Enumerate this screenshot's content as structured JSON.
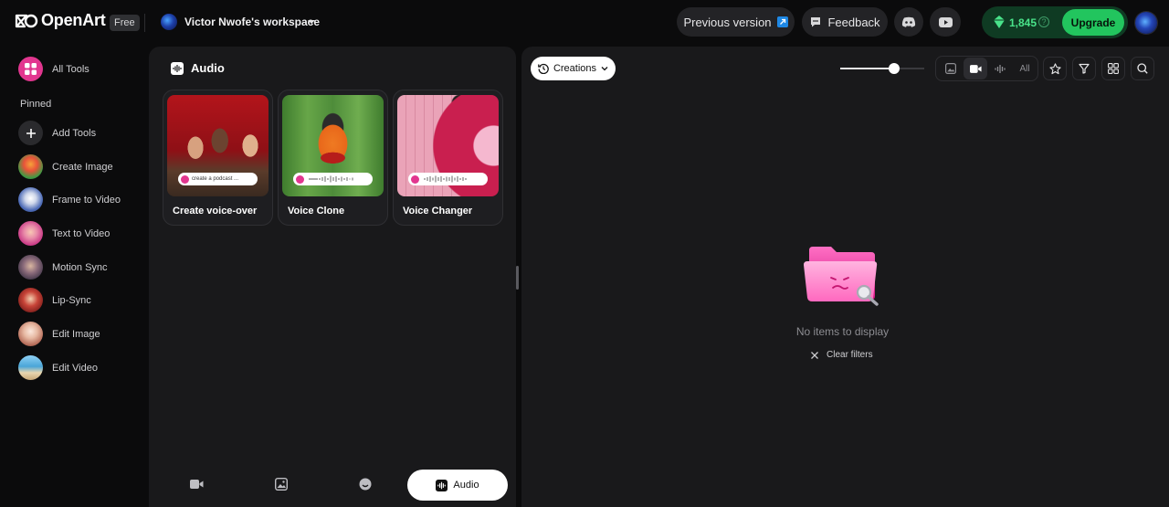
{
  "brand": {
    "name": "OpenArt",
    "plan": "Free"
  },
  "workspace": {
    "name": "Victor Nwofe's workspace"
  },
  "header": {
    "previous_version": "Previous version",
    "feedback": "Feedback",
    "credits": "1,845",
    "upgrade": "Upgrade"
  },
  "sidebar": {
    "all_tools": "All Tools",
    "pinned_label": "Pinned",
    "items": [
      {
        "label": "Add Tools"
      },
      {
        "label": "Create Image"
      },
      {
        "label": "Frame to Video"
      },
      {
        "label": "Text to Video"
      },
      {
        "label": "Motion Sync"
      },
      {
        "label": "Lip-Sync"
      },
      {
        "label": "Edit Image"
      },
      {
        "label": "Edit Video"
      }
    ]
  },
  "audio_panel": {
    "title": "Audio",
    "tools": [
      {
        "label": "Create voice-over",
        "thumb_caption": "create a podcast ..."
      },
      {
        "label": "Voice Clone"
      },
      {
        "label": "Voice Changer"
      }
    ],
    "tabs": [
      {
        "name": "video-tab-icon"
      },
      {
        "name": "image-tab-icon"
      },
      {
        "name": "character-tab-icon"
      },
      {
        "label": "Audio"
      }
    ]
  },
  "gallery": {
    "creations_label": "Creations",
    "zoom_level": 0.64,
    "filter_all": "All",
    "empty_text": "No items to display",
    "clear_filters": "Clear filters"
  },
  "colors": {
    "accent_green": "#22c55e",
    "credits_green": "#49e38a",
    "brand_pink": "#e2368f"
  }
}
